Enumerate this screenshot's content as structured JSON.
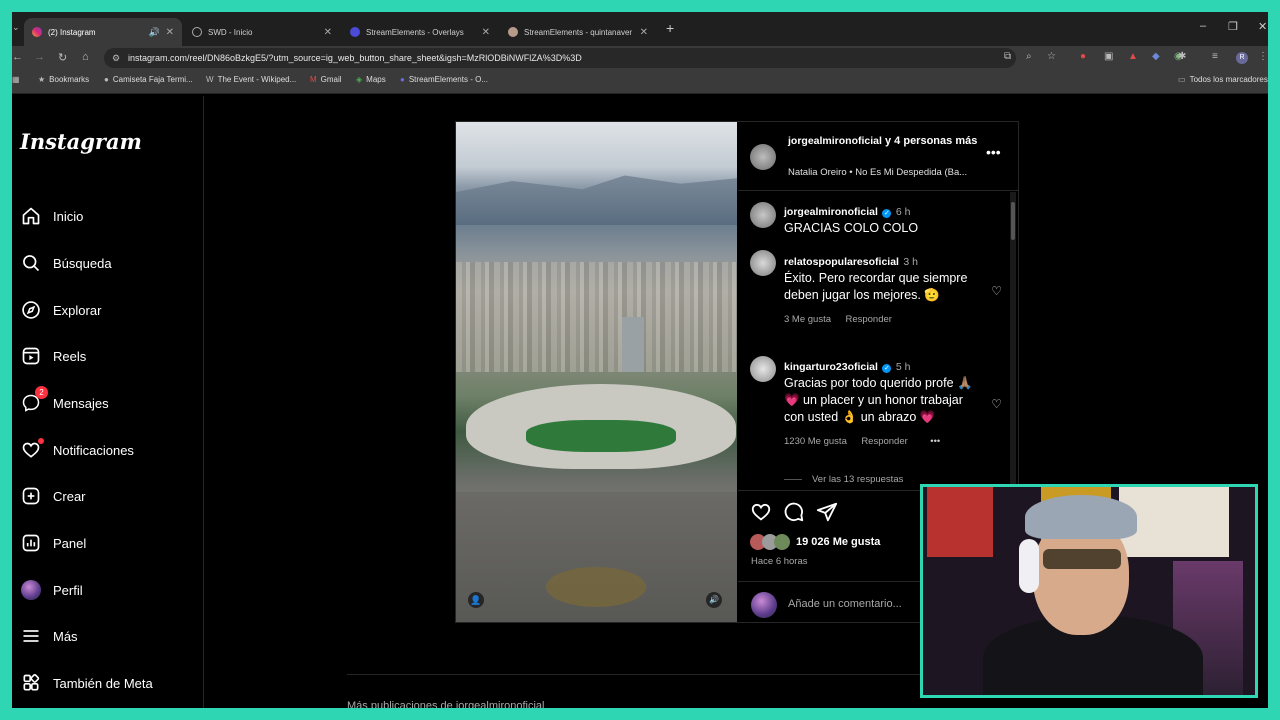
{
  "browser": {
    "tabs": [
      {
        "label": "(2) Instagram",
        "active": true
      },
      {
        "label": "SWD - Inicio"
      },
      {
        "label": "StreamElements - Overlays"
      },
      {
        "label": "StreamElements - quintanavers"
      }
    ],
    "url": "instagram.com/reel/DN86oBzkgE5/?utm_source=ig_web_button_share_sheet&igsh=MzRlODBiNWFlZA%3D%3D",
    "bookmarks": [
      "Bookmarks",
      "Camiseta Faja Termi...",
      "The Event - Wikiped...",
      "Gmail",
      "Maps",
      "StreamElements - O..."
    ],
    "other_bookmarks": "Todos los marcadores"
  },
  "sidebar": {
    "logo": "Instagram",
    "items": [
      {
        "label": "Inicio",
        "icon": "home-icon"
      },
      {
        "label": "Búsqueda",
        "icon": "search-icon"
      },
      {
        "label": "Explorar",
        "icon": "compass-icon"
      },
      {
        "label": "Reels",
        "icon": "reels-icon"
      },
      {
        "label": "Mensajes",
        "icon": "messenger-icon",
        "badge": "2"
      },
      {
        "label": "Notificaciones",
        "icon": "heart-icon"
      },
      {
        "label": "Crear",
        "icon": "plus-icon"
      },
      {
        "label": "Panel",
        "icon": "chart-icon"
      },
      {
        "label": "Perfil",
        "icon": "profile-avatar"
      },
      {
        "label": "Más",
        "icon": "menu-icon"
      },
      {
        "label": "También de Meta",
        "icon": "meta-icon"
      }
    ]
  },
  "post": {
    "author": "jorgealmironoficial",
    "author_suffix": "y 4 personas más",
    "audio": "Natalia Oreiro • No Es Mi Despedida (Ba...",
    "caption": {
      "user": "jorgealmironoficial",
      "time": "6 h",
      "text": "GRACIAS COLO COLO"
    },
    "comments": [
      {
        "user": "relatospopularesoficial",
        "time": "3 h",
        "text": "Éxito. Pero recordar que siempre deben jugar los mejores. 🫡",
        "likes": "3 Me gusta",
        "reply": "Responder"
      },
      {
        "user": "kingarturo23oficial",
        "time": "5 h",
        "text": "Gracias por todo querido profe 🙏🏽💗 un placer y un honor trabajar con usted 👌 un abrazo 💗",
        "likes": "1230 Me gusta",
        "reply": "Responder",
        "replies": "Ver las 13 respuestas"
      }
    ],
    "likes": "19 026 Me gusta",
    "posted": "Hace 6 horas",
    "comment_placeholder": "Añade un comentario..."
  },
  "more_posts": "Más publicaciones de jorgealmironoficial",
  "colors": {
    "accent_border": "#2fd6b4",
    "badge": "#ff3040",
    "verified": "#0095f6"
  }
}
